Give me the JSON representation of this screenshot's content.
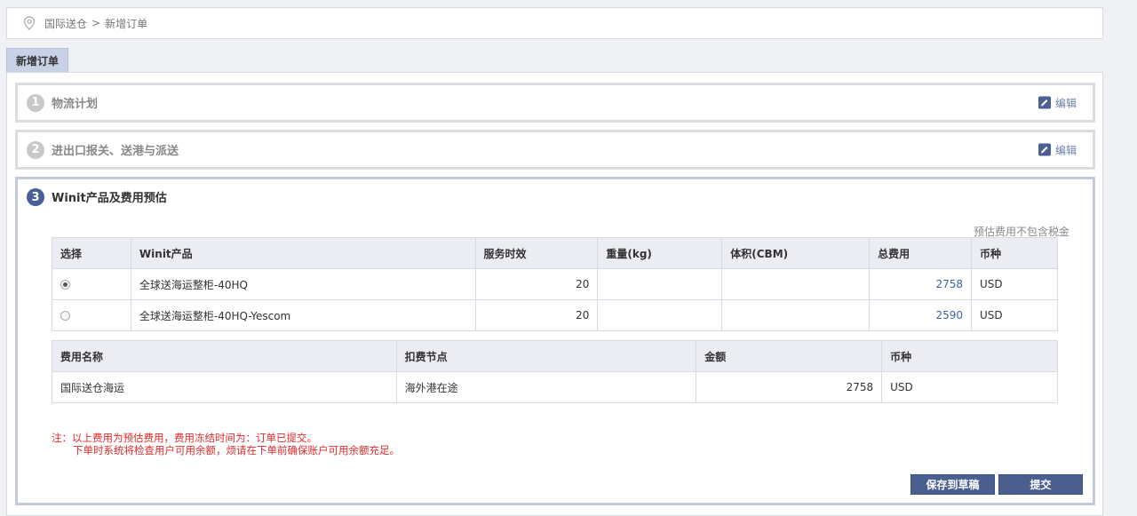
{
  "breadcrumb": {
    "root": "国际送仓",
    "separator": ">",
    "current": "新增订单"
  },
  "tab": {
    "label": "新增订单"
  },
  "steps": [
    {
      "number": "1",
      "title": "物流计划",
      "edit": "编辑"
    },
    {
      "number": "2",
      "title": "进出口报关、送港与派送",
      "edit": "编辑"
    },
    {
      "number": "3",
      "title": "Winit产品及费用预估"
    }
  ],
  "estimate_note": "预估费用不包含税金",
  "product_table": {
    "headers": [
      "选择",
      "Winit产品",
      "服务时效",
      "重量(kg)",
      "体积(CBM)",
      "总费用",
      "币种"
    ],
    "rows": [
      {
        "selected": true,
        "product": "全球送海运整柜-40HQ",
        "service_days": "20",
        "weight": "",
        "volume": "",
        "total": "2758",
        "currency": "USD"
      },
      {
        "selected": false,
        "product": "全球送海运整柜-40HQ-Yescom",
        "service_days": "20",
        "weight": "",
        "volume": "",
        "total": "2590",
        "currency": "USD"
      }
    ]
  },
  "fee_table": {
    "headers": [
      "费用名称",
      "扣费节点",
      "金额",
      "币种"
    ],
    "rows": [
      {
        "name": "国际送仓海运",
        "node": "海外港在途",
        "amount": "2758",
        "currency": "USD"
      }
    ]
  },
  "warning": {
    "line1": "注：以上费用为预估费用，费用冻结时间为：订单已提交。",
    "line2": "下单时系统将检查用户可用余额，烦请在下单前确保账户可用余额充足。"
  },
  "buttons": {
    "save": "保存到草稿",
    "submit": "提交"
  },
  "colors": {
    "primary": "#4a5f8f",
    "warning": "#e02a2a",
    "link": "#3a64a8"
  }
}
